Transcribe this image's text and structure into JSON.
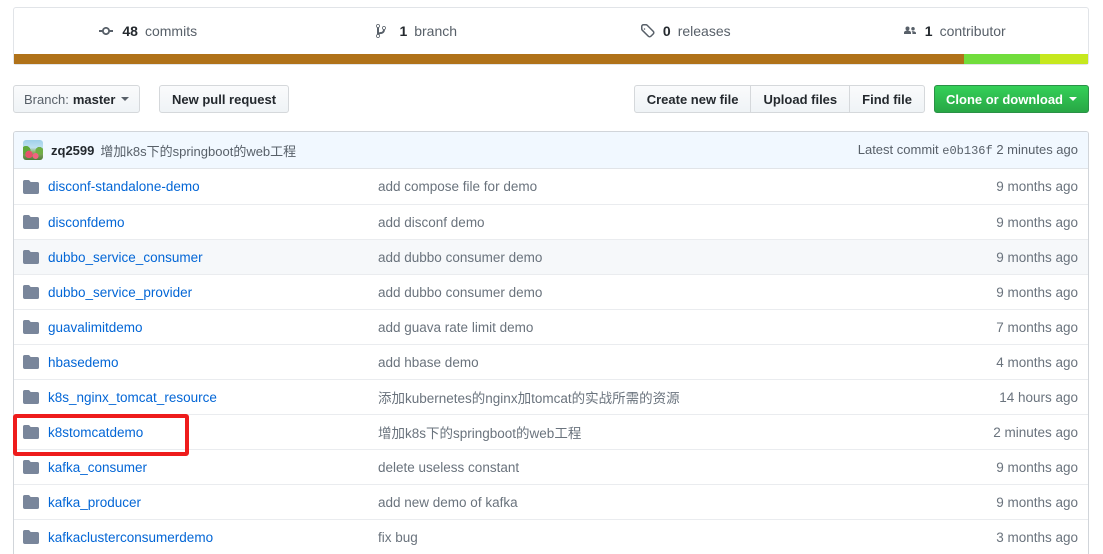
{
  "stats": [
    {
      "icon": "git-commit-icon",
      "value": "48",
      "label": "commits",
      "name": "commits-stat"
    },
    {
      "icon": "git-branch-icon",
      "value": "1",
      "label": "branch",
      "name": "branches-stat"
    },
    {
      "icon": "tag-icon",
      "value": "0",
      "label": "releases",
      "name": "releases-stat"
    },
    {
      "icon": "people-icon",
      "value": "1",
      "label": "contributor",
      "name": "contributors-stat"
    }
  ],
  "language_bar": [
    {
      "name": "language-segment-1",
      "color": "#b07219",
      "percent": 88.5
    },
    {
      "name": "language-segment-2",
      "color": "#71dd3c",
      "percent": 7.0
    },
    {
      "name": "language-segment-3",
      "color": "#c6e81e",
      "percent": 4.5
    }
  ],
  "toolbar": {
    "branch_prefix": "Branch:",
    "branch_name": "master",
    "new_pull_request": "New pull request",
    "create_new_file": "Create new file",
    "upload_files": "Upload files",
    "find_file": "Find file",
    "clone_or_download": "Clone or download"
  },
  "commit_bar": {
    "author": "zq2599",
    "message": "增加k8s下的springboot的web工程",
    "latest_commit_label": "Latest commit",
    "sha": "e0b136f",
    "time": "2 minutes ago"
  },
  "files": [
    {
      "type": "folder",
      "name": "disconf-standalone-demo",
      "message": "add compose file for demo",
      "time": "9 months ago",
      "highlighted": false,
      "annotated": false
    },
    {
      "type": "folder",
      "name": "disconfdemo",
      "message": "add disconf demo",
      "time": "9 months ago",
      "highlighted": false,
      "annotated": false
    },
    {
      "type": "folder",
      "name": "dubbo_service_consumer",
      "message": "add dubbo consumer demo",
      "time": "9 months ago",
      "highlighted": true,
      "annotated": false
    },
    {
      "type": "folder",
      "name": "dubbo_service_provider",
      "message": "add dubbo consumer demo",
      "time": "9 months ago",
      "highlighted": false,
      "annotated": false
    },
    {
      "type": "folder",
      "name": "guavalimitdemo",
      "message": "add guava rate limit demo",
      "time": "7 months ago",
      "highlighted": false,
      "annotated": false
    },
    {
      "type": "folder",
      "name": "hbasedemo",
      "message": "add hbase demo",
      "time": "4 months ago",
      "highlighted": false,
      "annotated": false
    },
    {
      "type": "folder",
      "name": "k8s_nginx_tomcat_resource",
      "message": "添加kubernetes的nginx加tomcat的实战所需的资源",
      "time": "14 hours ago",
      "highlighted": false,
      "annotated": false
    },
    {
      "type": "folder",
      "name": "k8stomcatdemo",
      "message": "增加k8s下的springboot的web工程",
      "time": "2 minutes ago",
      "highlighted": false,
      "annotated": true
    },
    {
      "type": "folder",
      "name": "kafka_consumer",
      "message": "delete useless constant",
      "time": "9 months ago",
      "highlighted": false,
      "annotated": false
    },
    {
      "type": "folder",
      "name": "kafka_producer",
      "message": "add new demo of kafka",
      "time": "9 months ago",
      "highlighted": false,
      "annotated": false
    },
    {
      "type": "folder",
      "name": "kafkaclusterconsumerdemo",
      "message": "fix bug",
      "time": "3 months ago",
      "highlighted": false,
      "annotated": false
    }
  ],
  "annotation": {
    "color": "#ee1c1c",
    "target": "k8stomcatdemo"
  }
}
